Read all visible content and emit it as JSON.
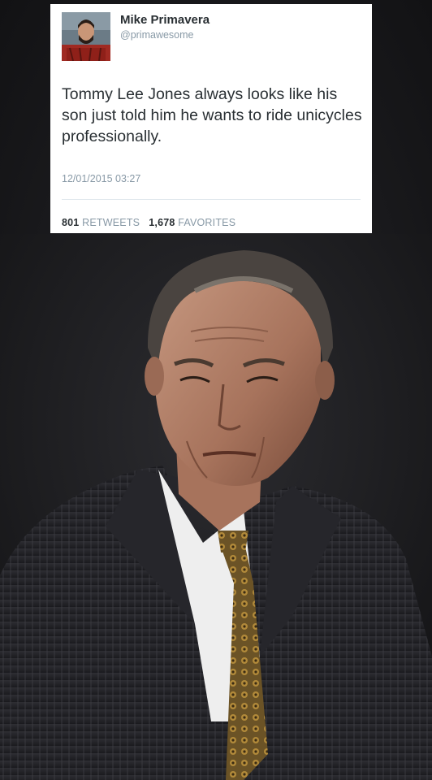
{
  "tweet": {
    "display_name": "Mike Primavera",
    "handle": "@primawesome",
    "text": "Tommy Lee Jones always looks like his son just told him he wants to ride unicycles professionally.",
    "timestamp": "12/01/2015 03:27",
    "retweets_count": "801",
    "retweets_label": "RETWEETS",
    "favorites_count": "1,678",
    "favorites_label": "FAVORITES"
  },
  "colors": {
    "background": "#1b1b1e",
    "card": "#ffffff",
    "text_primary": "#292f33",
    "text_secondary": "#8899a6"
  }
}
